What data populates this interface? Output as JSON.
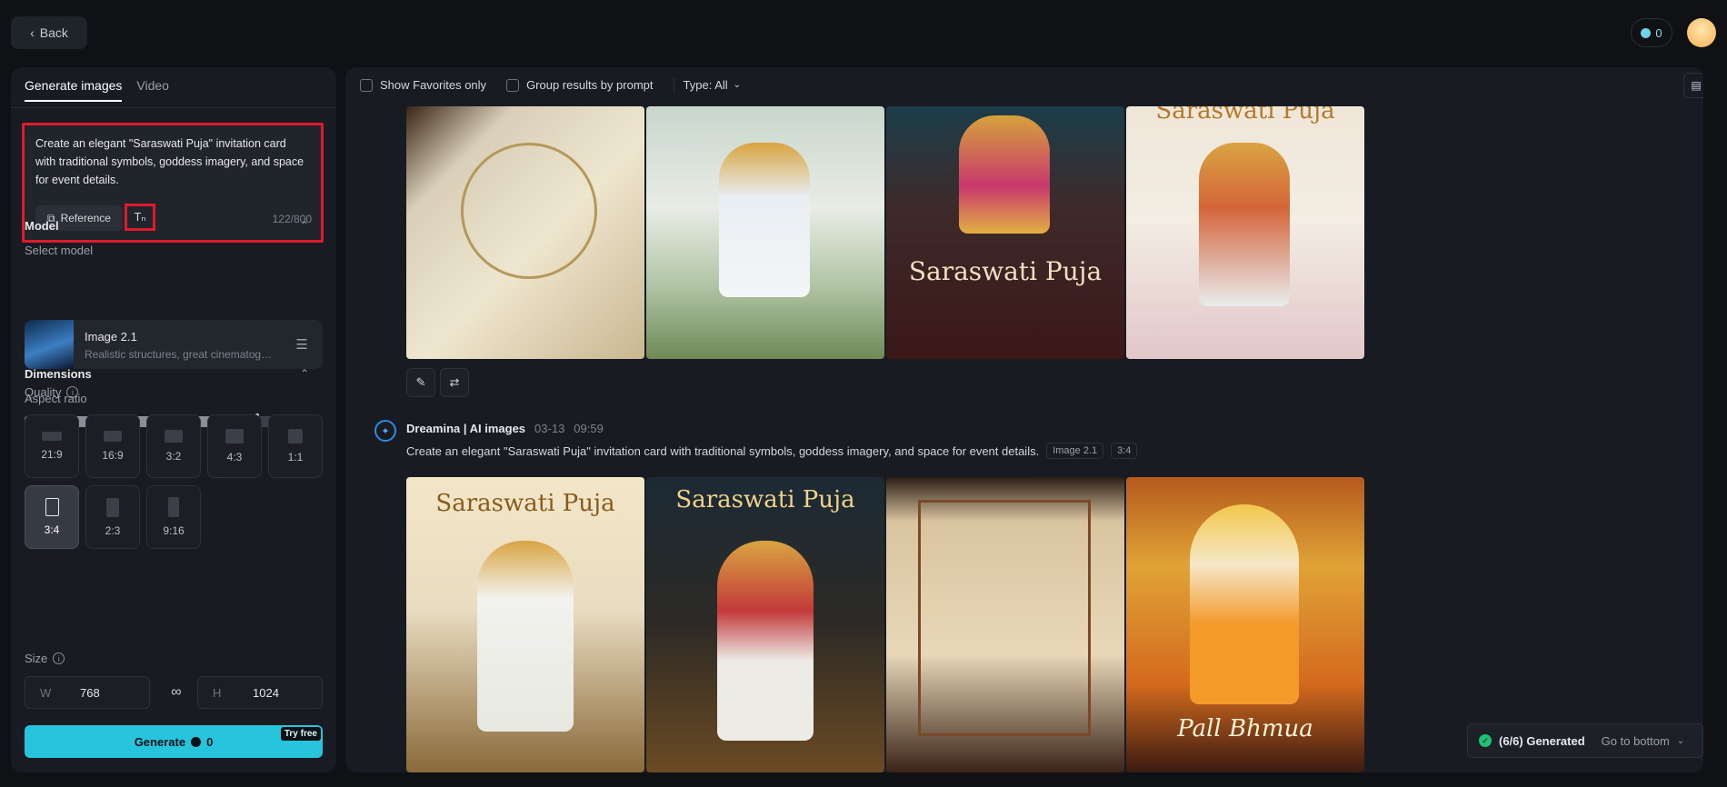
{
  "header": {
    "back_label": "Back",
    "credits": "0"
  },
  "sidebar": {
    "tabs": [
      "Generate images",
      "Video"
    ],
    "prompt": "Create an elegant \"Saraswati Puja\" invitation card with traditional symbols, goddess imagery, and space for event details.",
    "reference_label": "Reference",
    "text_tool_glyph": "Tₙ",
    "char_count": "122/800",
    "model_section": "Model",
    "select_model_label": "Select model",
    "model_name": "Image 2.1",
    "model_desc": "Realistic structures, great cinematography",
    "quality_label": "Quality",
    "quality_value": "9",
    "quality_fraction": 0.9,
    "dimensions_section": "Dimensions",
    "aspect_ratio_label": "Aspect ratio",
    "ratios": [
      "21:9",
      "16:9",
      "3:2",
      "4:3",
      "1:1",
      "3:4",
      "2:3",
      "9:16"
    ],
    "selected_ratio": "3:4",
    "size_label": "Size",
    "width_prefix": "W",
    "width_value": "768",
    "height_prefix": "H",
    "height_value": "1024",
    "generate_label": "Generate",
    "generate_cost": "0",
    "try_free": "Try free"
  },
  "filters": {
    "favorites": "Show Favorites only",
    "group": "Group results by prompt",
    "type": "Type: All"
  },
  "batch1": {
    "captions": [
      "",
      "",
      "Saraswati Puja",
      "Saraswati Puja"
    ]
  },
  "batch2": {
    "author": "Dreamina | AI images",
    "date": "03-13",
    "time": "09:59",
    "prompt": "Create an elegant \"Saraswati Puja\" invitation card with traditional symbols, goddess imagery, and space for event details.",
    "model_chip": "Image 2.1",
    "ratio_chip": "3:4",
    "captions": [
      "Saraswati Puja",
      "Saraswati Puja",
      "",
      "Pall Bhmua"
    ]
  },
  "toast": {
    "status": "(6/6) Generated",
    "goto": "Go to bottom"
  },
  "colors": {
    "accent": "#26c5dd",
    "highlight": "#e0192c",
    "success": "#1fbf74"
  }
}
